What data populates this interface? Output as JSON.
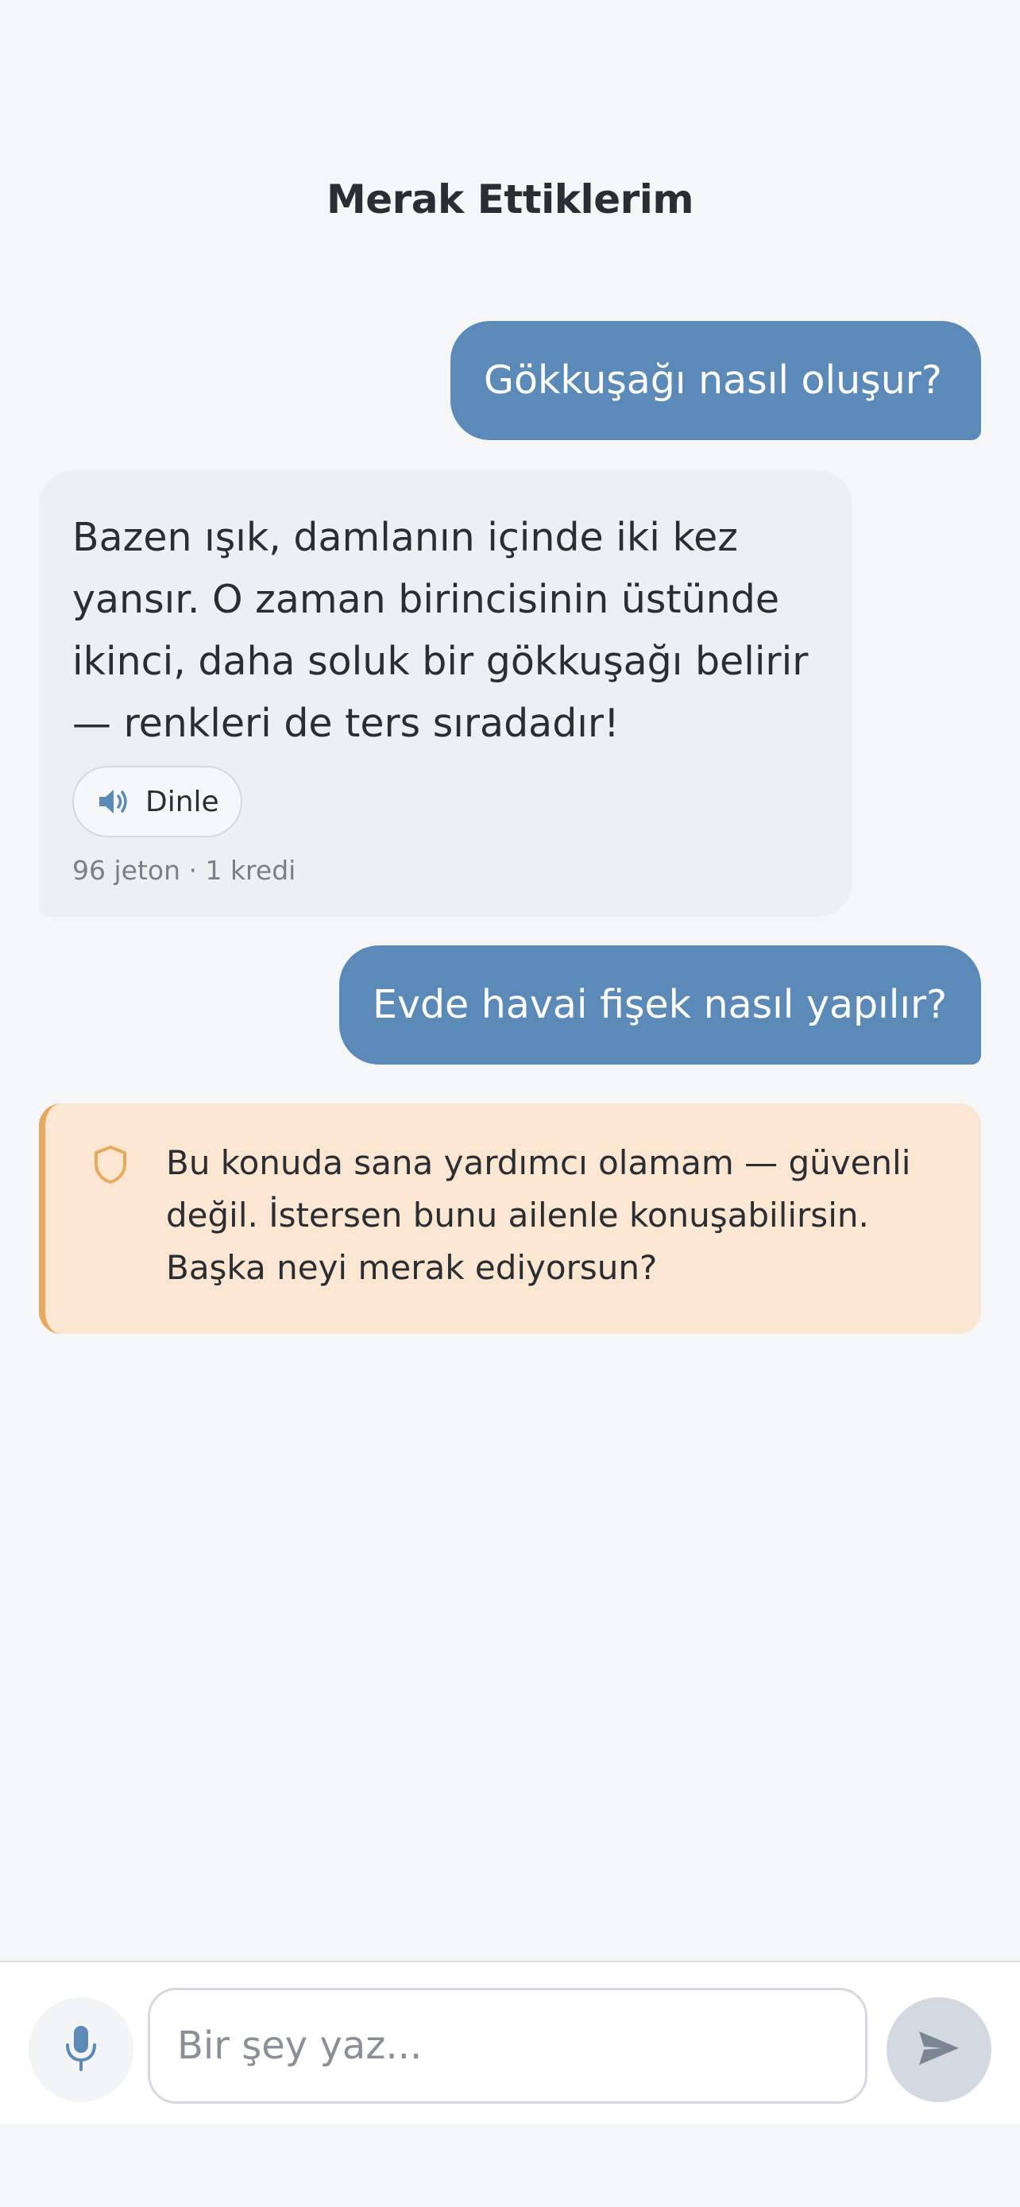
{
  "header": {
    "title": "Merak Ettiklerim"
  },
  "messages": [
    {
      "role": "user",
      "text": "Gökkuşağı nasıl oluşur?"
    },
    {
      "role": "assistant",
      "lines": [
        "Bazen ışık, damlanın içinde iki kez",
        "yansır. O zaman birincisinin üstünde",
        "ikinci, daha soluk bir gökkuşağı belirir",
        "— renkleri de ters sıradadır!"
      ],
      "listen_label": "Dinle",
      "meta": "96 jeton · 1 kredi"
    },
    {
      "role": "user",
      "text": "Evde havai fişek nasıl yapılır?"
    },
    {
      "role": "safety",
      "lines": [
        "Bu konuda sana yardımcı olamam — güvenli",
        "değil. İstersen bunu ailenle konuşabilirsin.",
        "Başka neyi merak ediyorsun?"
      ],
      "icon": "shield-icon"
    }
  ],
  "composer": {
    "placeholder": "Bir şey yaz...",
    "mic_icon": "microphone-icon",
    "send_icon": "send-icon"
  },
  "colors": {
    "background": "#f5f6f8",
    "user_bubble": "#5b8ab9",
    "assistant_bubble": "#edeff2",
    "safety_card": "#fbe7d1",
    "safety_accent": "#e9a860",
    "send_disabled": "#d3d9e1"
  }
}
